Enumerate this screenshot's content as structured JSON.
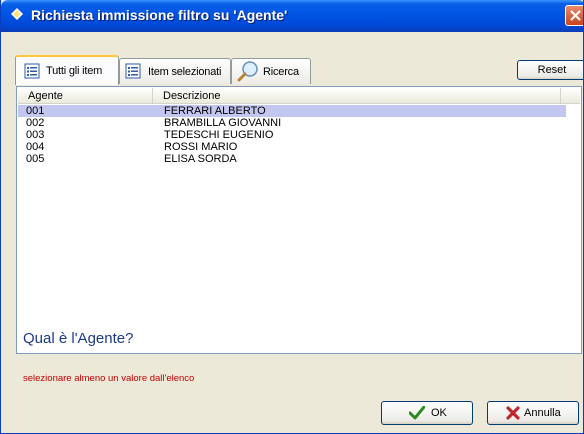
{
  "window": {
    "title": "Richiesta immissione filtro su 'Agente'"
  },
  "tabs": [
    {
      "label": "Tutti gli item",
      "icon": "list-icon",
      "active": true
    },
    {
      "label": "Item selezionati",
      "icon": "checklist-icon",
      "active": false
    },
    {
      "label": "Ricerca",
      "icon": "magnifier-icon",
      "active": false
    }
  ],
  "toolbar": {
    "reset_label": "Reset"
  },
  "list": {
    "columns": [
      "Agente",
      "Descrizione"
    ],
    "rows": [
      {
        "code": "001",
        "description": "FERRARI ALBERTO",
        "selected": true
      },
      {
        "code": "002",
        "description": "BRAMBILLA GIOVANNI",
        "selected": false
      },
      {
        "code": "003",
        "description": "TEDESCHI EUGENIO",
        "selected": false
      },
      {
        "code": "004",
        "description": "ROSSI MARIO",
        "selected": false
      },
      {
        "code": "005",
        "description": "ELISA SORDA",
        "selected": false
      }
    ]
  },
  "prompt": {
    "question": "Qual è l'Agente?",
    "hint": "selezionare almeno un valore dall'elenco"
  },
  "buttons": {
    "ok_label": "OK",
    "cancel_label": "Annulla"
  },
  "colors": {
    "title_bar": "#0054e3",
    "selection": "#c3c7ef",
    "question_text": "#1a3b8c",
    "hint_text": "#c00000",
    "ok_check": "#2e8b1f",
    "cancel_x": "#c1272d"
  }
}
